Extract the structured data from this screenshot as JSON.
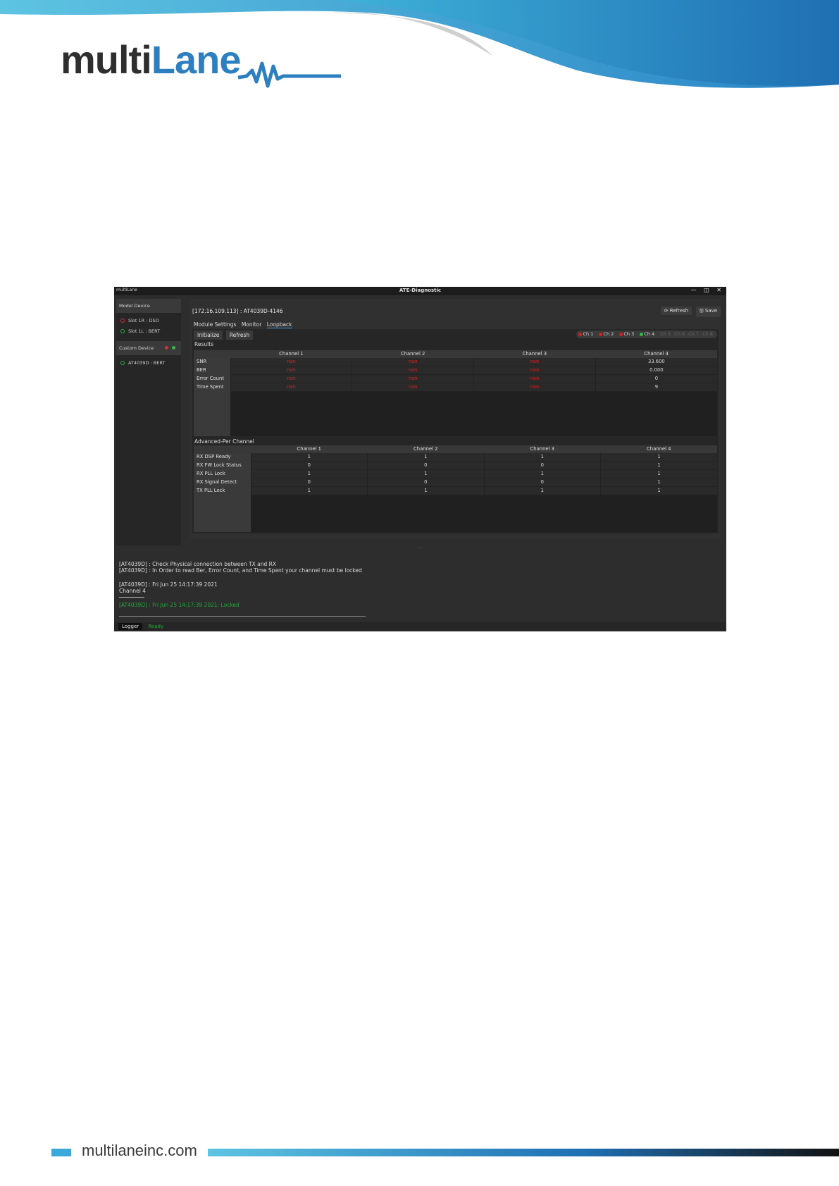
{
  "header": {
    "logo_multi": "multi",
    "logo_lane": "Lane"
  },
  "window": {
    "brand": "multiLane",
    "title": "ATE-Diagnostic",
    "controls": "— ◫ ✕"
  },
  "sidebar": {
    "model_device_label": "Model Device",
    "model_items": [
      "Slot 1R : DSO",
      "Slot 1L : BERT"
    ],
    "custom_device_label": "Custom Device",
    "custom_items": [
      "AT4039D : BERT"
    ]
  },
  "main": {
    "device_title": "[172.16.109.113] : AT4039D-4146",
    "refresh_label": "⟳ Refresh",
    "save_label": "🖫 Save",
    "tabs": [
      "Module Settings",
      "Monitor",
      "Loopback"
    ],
    "initialize_label": "Initialize",
    "panel_refresh_label": "Refresh",
    "channels": [
      "Ch 1",
      "Ch 2",
      "Ch 3",
      "Ch 4",
      "Ch 5",
      "Ch 6",
      "Ch 7",
      "Ch 8"
    ]
  },
  "results": {
    "label": "Results",
    "columns": [
      "Channel 1",
      "Channel 2",
      "Channel 3",
      "Channel 4"
    ],
    "rows": [
      {
        "label": "SNR",
        "values": [
          "nan",
          "nan",
          "nan",
          "33.600"
        ]
      },
      {
        "label": "BER",
        "values": [
          "nan",
          "nan",
          "nan",
          "0.000"
        ]
      },
      {
        "label": "Error Count",
        "values": [
          "nan",
          "nan",
          "nan",
          "0"
        ]
      },
      {
        "label": "Time Spent",
        "values": [
          "nan",
          "nan",
          "nan",
          "9"
        ]
      }
    ]
  },
  "advanced": {
    "label": "Advanced-Per Channel",
    "columns": [
      "Channel 1",
      "Channel 2",
      "Channel 3",
      "Channel 4"
    ],
    "rows": [
      {
        "label": "RX DSP Ready",
        "values": [
          "1",
          "1",
          "1",
          "1"
        ]
      },
      {
        "label": "RX FW Lock Status",
        "values": [
          "0",
          "0",
          "0",
          "1"
        ]
      },
      {
        "label": "RX PLL Lock",
        "values": [
          "1",
          "1",
          "1",
          "1"
        ]
      },
      {
        "label": "RX Signal Detect",
        "values": [
          "0",
          "0",
          "0",
          "1"
        ]
      },
      {
        "label": "TX PLL Lock",
        "values": [
          "1",
          "1",
          "1",
          "1"
        ]
      }
    ]
  },
  "log": {
    "line1": "[AT4039D] : Check Physical connection between TX and RX",
    "line2": "[AT4039D] : In Order to read Ber, Error Count, and Time Spent your channel must be locked",
    "line3": "[AT4039D] : Fri Jun 25 14:17:39 2021",
    "line4": "Channel 4",
    "line5": "[AT4039D] : Fri Jun 25 14:17:39 2021: Locked",
    "logger_tab": "Logger",
    "status": "Ready"
  },
  "footer": {
    "site": "multilaneinc.com"
  }
}
